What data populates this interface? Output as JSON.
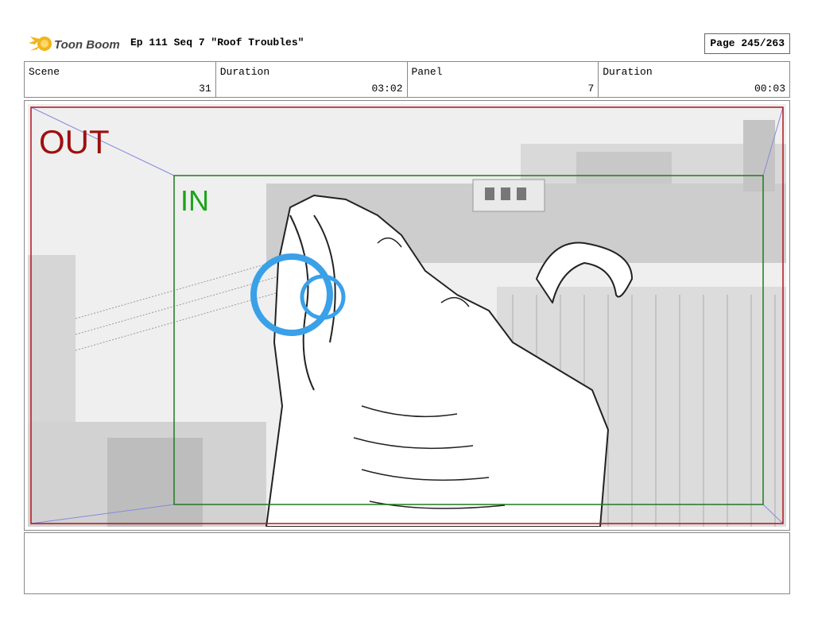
{
  "header": {
    "logo_text": "Toon Boom",
    "title": "Ep 111 Seq 7 \"Roof Troubles\"",
    "page": "Page 245/263"
  },
  "info": [
    {
      "label": "Scene",
      "value": "31"
    },
    {
      "label": "Duration",
      "value": "03:02"
    },
    {
      "label": "Panel",
      "value": "7"
    },
    {
      "label": "Duration",
      "value": "00:03"
    }
  ],
  "panel": {
    "out_label": "OUT",
    "in_label": "IN",
    "colors": {
      "out_frame": "#b5121b",
      "in_frame": "#1e7a1e",
      "in_text": "#1aa51a",
      "rings": "#3aa0e8"
    }
  },
  "notes": ""
}
